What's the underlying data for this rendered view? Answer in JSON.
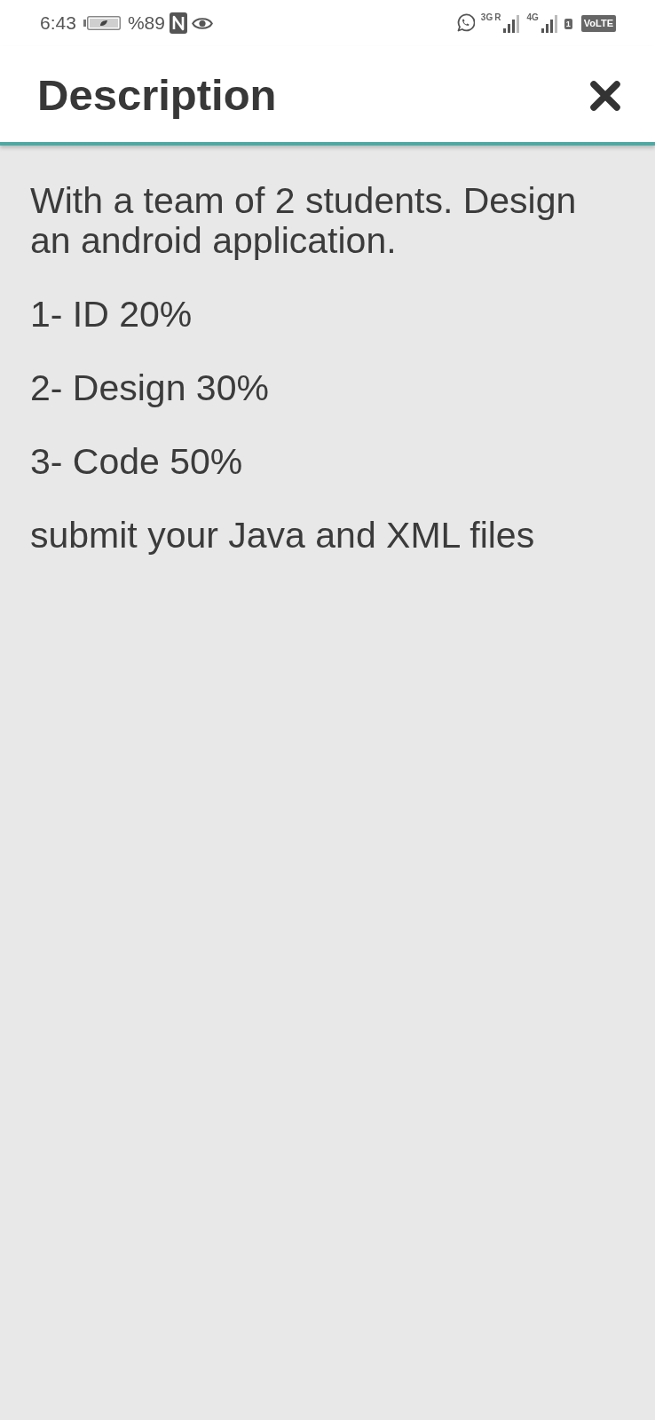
{
  "status_bar": {
    "time": "6:43",
    "battery": "%89",
    "network_1": "3G",
    "roaming": "R",
    "network_2": "4G",
    "sim": "1",
    "volte": "VoLTE"
  },
  "header": {
    "title": "Description"
  },
  "description": {
    "paragraphs": [
      "With a team of 2 students. Design an android application.",
      "1- ID 20%",
      "2- Design 30%",
      "3- Code 50%",
      "submit your Java and XML files"
    ]
  }
}
